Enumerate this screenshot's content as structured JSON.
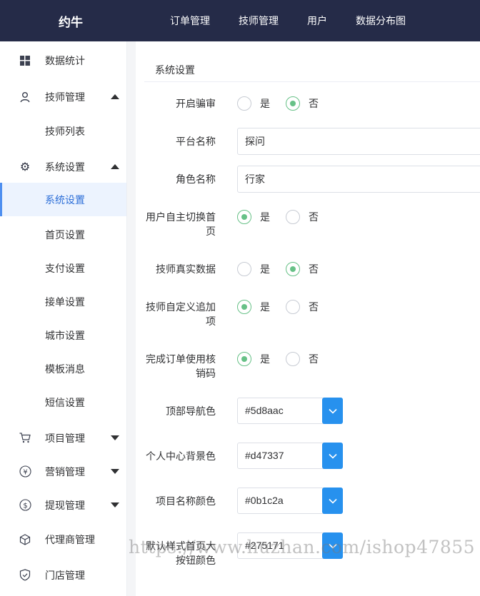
{
  "app": {
    "logo": "约牛"
  },
  "nav": [
    "订单管理",
    "技师管理",
    "用户",
    "数据分布图"
  ],
  "sidebar": [
    {
      "label": "数据统计",
      "icon": "windows-icon"
    },
    {
      "label": "技师管理",
      "icon": "user-icon",
      "expanded": true
    },
    {
      "label": "技师列表"
    },
    {
      "label": "系统设置",
      "icon": "gear-icon",
      "expanded": true
    },
    {
      "label": "系统设置",
      "active": true
    },
    {
      "label": "首页设置"
    },
    {
      "label": "支付设置"
    },
    {
      "label": "接单设置"
    },
    {
      "label": "城市设置"
    },
    {
      "label": "模板消息"
    },
    {
      "label": "短信设置"
    },
    {
      "label": "项目管理",
      "icon": "cart-icon",
      "expanded": false
    },
    {
      "label": "营销管理",
      "icon": "yen-icon",
      "expanded": false
    },
    {
      "label": "提现管理",
      "icon": "dollar-icon",
      "expanded": false
    },
    {
      "label": "代理商管理",
      "icon": "cube-icon"
    },
    {
      "label": "门店管理",
      "icon": "shield-icon"
    }
  ],
  "page": {
    "title": "系统设置"
  },
  "options": {
    "yes": "是",
    "no": "否"
  },
  "form": {
    "review": {
      "label": "开启骗审",
      "value": "否"
    },
    "platform_name": {
      "label": "平台名称",
      "value": "探问"
    },
    "role_name": {
      "label": "角色名称",
      "value": "行家"
    },
    "switch_home": {
      "label_line1": "用户自主切换首",
      "label_line2": "页",
      "value": "是"
    },
    "real_data": {
      "label": "技师真实数据",
      "value": "否"
    },
    "custom_items": {
      "label_line1": "技师自定义追加",
      "label_line2": "项",
      "value": "是"
    },
    "verify_code": {
      "label_line1": "完成订单使用核",
      "label_line2": "销码",
      "value": "是"
    },
    "top_nav_color": {
      "label": "顶部导航色",
      "value": "#5d8aac"
    },
    "center_bg_color": {
      "label": "个人中心背景色",
      "value": "#d47337"
    },
    "item_name_color": {
      "label": "项目名称颜色",
      "value": "#0b1c2a"
    },
    "home_button_color": {
      "label_line1": "默认样式首页大",
      "label_line2": "按钮颜色",
      "value": "#275171"
    }
  },
  "colors": {
    "topbar": "#252b48",
    "radio_on": "#67c187",
    "dropdown": "#2791ee",
    "active_menu": "#2d6fd8"
  },
  "watermark": "https://www.huzhan.com/ishop47855"
}
